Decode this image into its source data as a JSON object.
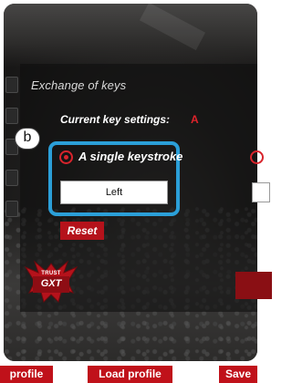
{
  "dialog": {
    "title": "Exchange of keys",
    "current_key_label": "Current key settings:",
    "current_key_value": "A",
    "marker": "b",
    "option_single_keystroke": {
      "label": "A single keystroke",
      "selected": true,
      "value": "Left"
    },
    "reset_label": "Reset"
  },
  "brand": {
    "logo_top": "TRUST",
    "logo_main": "GXT"
  },
  "bottom_bar": {
    "profile_label": "profile",
    "load_profile_label": "Load profile",
    "save_label": "Save"
  },
  "colors": {
    "accent_red": "#c0111a",
    "highlight_blue": "#2b9fd8",
    "background_dark": "#1e1d1c"
  }
}
